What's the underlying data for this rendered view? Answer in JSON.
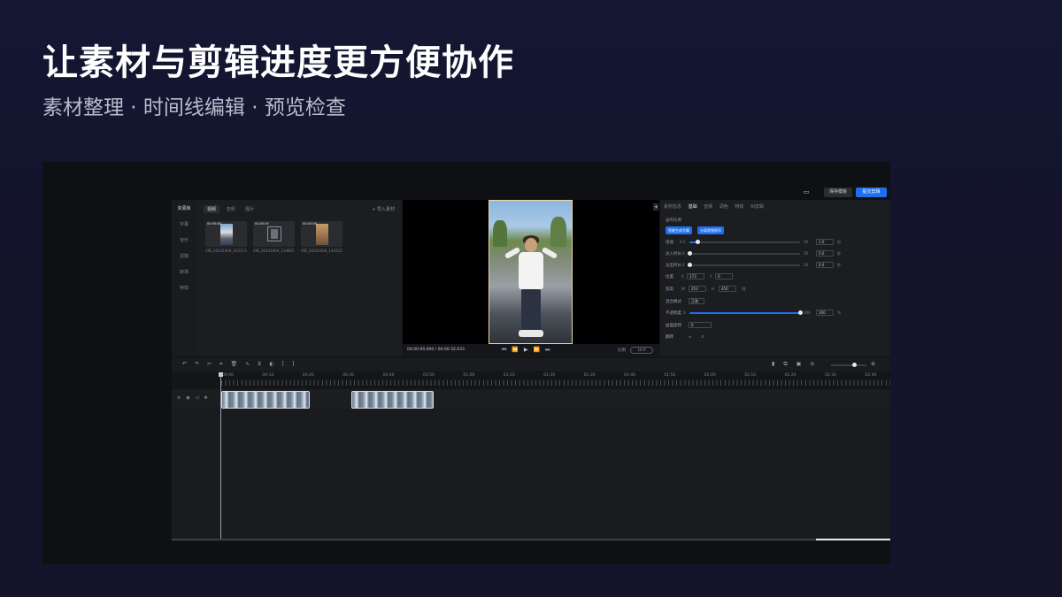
{
  "hero": {
    "title": "让素材与剪辑进度更方便协作",
    "subtitle": "素材整理 · 时间线编辑 · 预览检查"
  },
  "topbar": {
    "save_label": "保存模板",
    "submit_label": "提交剪辑"
  },
  "leftnav": {
    "items": [
      {
        "label": "资源库"
      },
      {
        "label": "字幕"
      },
      {
        "label": "音乐"
      },
      {
        "label": "滤镜"
      },
      {
        "label": "转场"
      },
      {
        "label": "特效"
      }
    ]
  },
  "media": {
    "tabs": [
      {
        "label": "视频",
        "active": true
      },
      {
        "label": "音频",
        "active": false
      },
      {
        "label": "图片",
        "active": false
      }
    ],
    "import_label": "+ 导入素材",
    "items": [
      {
        "time": "00:00:08",
        "caption": "VID_20241004_102113..."
      },
      {
        "time": "00:00:05",
        "caption": "VID_20241004_114601..."
      },
      {
        "time": "00:00:06",
        "caption": "VID_20241004_144322..."
      }
    ]
  },
  "preview": {
    "timecode": "00:00:00.000 / 00:00:32.633",
    "ratio_label": "比例",
    "ratio_value": "16:9"
  },
  "props": {
    "tabs": [
      {
        "label": "素材信息",
        "active": false
      },
      {
        "label": "基础",
        "active": true
      },
      {
        "label": "音频",
        "active": false
      },
      {
        "label": "调色",
        "active": false
      },
      {
        "label": "特效",
        "active": false
      },
      {
        "label": "AI剪辑",
        "active": false
      }
    ],
    "section_label": "画布比例",
    "pill_a": "智能生成字幕",
    "pill_b": "分离视频原声",
    "speed": {
      "label": "倍速",
      "min": "0.1",
      "max": "10",
      "value": "1.0",
      "unit": "倍",
      "level": 0.07
    },
    "fade_in": {
      "label": "淡入时长",
      "min": "0",
      "max": "10",
      "value": "0.0",
      "unit": "秒",
      "level": 0.0
    },
    "fade_out": {
      "label": "淡出时长",
      "min": "0",
      "max": "10",
      "value": "0.0",
      "unit": "秒",
      "level": 0.0
    },
    "position": {
      "label": "位置",
      "x_label": "X",
      "x": "273",
      "y_label": "Y",
      "y": "0"
    },
    "size": {
      "label": "宽高",
      "w_label": "W",
      "w": "253",
      "h_label": "H",
      "h": "450"
    },
    "blend": {
      "label": "混合模式",
      "value": "正常"
    },
    "opacity": {
      "label": "不透明度",
      "min": "0",
      "max": "100",
      "value": "100",
      "unit": "%",
      "level": 1.0
    },
    "rotate": {
      "label": "画面旋转",
      "value": "0"
    },
    "flip": {
      "label": "翻转"
    }
  },
  "timeline": {
    "ticks": [
      "00:00",
      "00:10",
      "00:20",
      "00:30",
      "00:40",
      "00:50",
      "01:00",
      "01:10",
      "01:20",
      "01:30",
      "01:40",
      "01:50",
      "02:00",
      "02:10",
      "02:20",
      "02:30",
      "02:40"
    ]
  },
  "colors": {
    "accent": "#1e6ff0",
    "background": "#141633"
  }
}
